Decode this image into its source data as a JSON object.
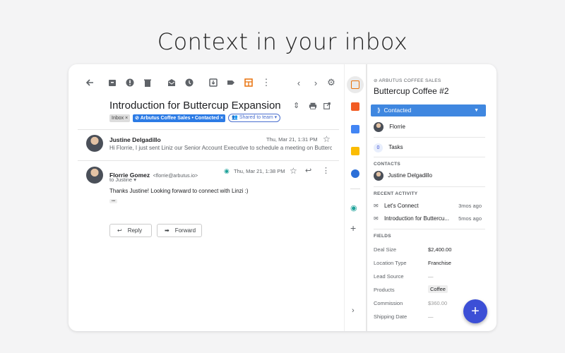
{
  "headline": "Context in your inbox",
  "email": {
    "subject": "Introduction for Buttercup Expansion",
    "labels": {
      "inbox": "Inbox",
      "arbutus": "Arbutus Coffee Sales • Contacted",
      "shared": "Shared to team"
    },
    "messages": [
      {
        "sender": "Justine Delgadillo",
        "date": "Thu, Mar 21, 1:31 PM",
        "snippet": "Hi Florrie, I just sent Liniz our Senior Account Executive to schedule a meeting on Buttercu..."
      },
      {
        "sender": "Florrie Gomez",
        "email": "<florrie@arbutus.io>",
        "to": "to Justine",
        "date": "Thu, Mar 21, 1:38 PM",
        "body": "Thanks Justine! Looking forward to connect with Linzi :)",
        "ellipsis": "•••"
      }
    ],
    "reply_label": "Reply",
    "forward_label": "Forward"
  },
  "crm": {
    "pipeline": "ARBUTUS COFFEE SALES",
    "title": "Buttercup Coffee #2",
    "stage": "Contacted",
    "owner": "Florrie",
    "tasks_count": "0",
    "tasks_label": "Tasks",
    "contacts_header": "CONTACTS",
    "contact": "Justine Delgadillo",
    "activity_header": "RECENT ACTIVITY",
    "activity": [
      {
        "title": "Let's Connect",
        "time": "3mos ago"
      },
      {
        "title": "Introduction for Buttercu...",
        "time": "5mos ago"
      }
    ],
    "fields_header": "FIELDS",
    "fields": [
      {
        "label": "Deal Size",
        "value": "$2,400.00"
      },
      {
        "label": "Location Type",
        "value": "Franchise"
      },
      {
        "label": "Lead Source",
        "value": "—"
      },
      {
        "label": "Products",
        "value": "Coffee"
      },
      {
        "label": "Commission",
        "value": "$360.00"
      },
      {
        "label": "Shipping Date",
        "value": "—"
      }
    ]
  },
  "colors": {
    "accent": "#2c7be5",
    "fab": "#3c4fd6",
    "stage": "#3f87e0"
  }
}
